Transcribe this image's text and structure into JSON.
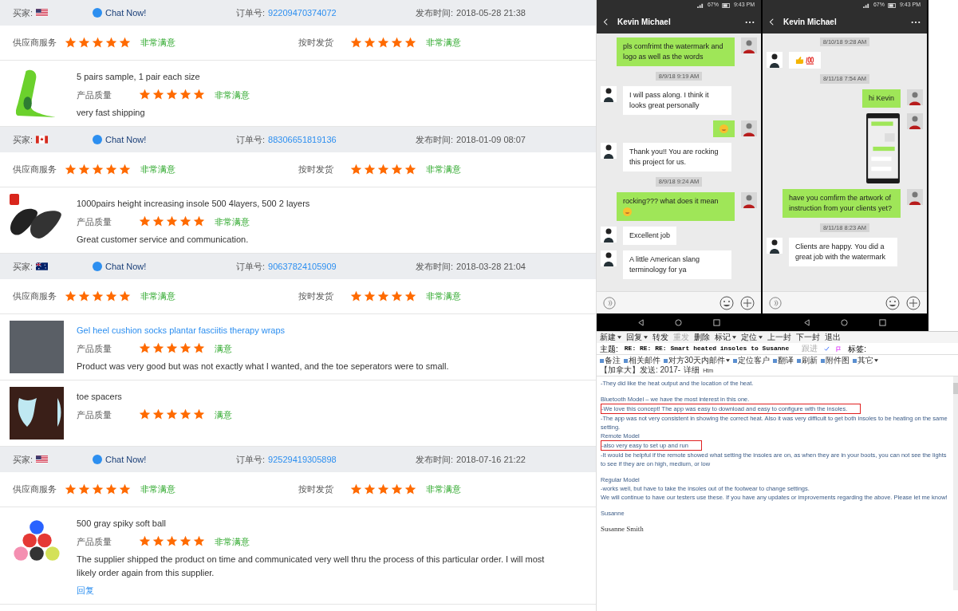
{
  "reviews": [
    {
      "buyer": {
        "label": "买家:",
        "kind": "us"
      },
      "chat": "Chat Now!",
      "order_label": "订单号:",
      "order_no": "92209470374072",
      "date_label": "发布时间:",
      "date": "2018-05-28 21:38",
      "ratings": [
        {
          "label": "供应商服务",
          "stars": 5,
          "verdict": "非常满意"
        },
        {
          "label": "按时发货",
          "stars": 5,
          "verdict": "非常满意"
        }
      ],
      "products": [
        {
          "kind": "green-insole",
          "hot": false,
          "title": "5 pairs sample, 1 pair each size",
          "link": false,
          "rating_label": "产品质量",
          "stars": 5,
          "verdict": "非常满意",
          "comment": "very fast shipping"
        }
      ]
    },
    {
      "buyer": {
        "label": "买家:",
        "kind": "ca"
      },
      "chat": "Chat Now!",
      "order_label": "订单号:",
      "order_no": "88306651819136",
      "date_label": "发布时间:",
      "date": "2018-01-09 08:07",
      "ratings": [
        {
          "label": "供应商服务",
          "stars": 5,
          "verdict": "非常满意"
        },
        {
          "label": "按时发货",
          "stars": 5,
          "verdict": "非常满意"
        }
      ],
      "products": [
        {
          "kind": "black-insole",
          "hot": true,
          "title": "1000pairs height increasing insole 500 4layers, 500 2 layers",
          "link": false,
          "rating_label": "产品质量",
          "stars": 5,
          "verdict": "非常满意",
          "comment": "Great customer service and communication."
        }
      ]
    },
    {
      "buyer": {
        "label": "买家:",
        "kind": "au"
      },
      "chat": "Chat Now!",
      "order_label": "订单号:",
      "order_no": "90637824105909",
      "date_label": "发布时间:",
      "date": "2018-03-28 21:04",
      "ratings": [
        {
          "label": "供应商服务",
          "stars": 5,
          "verdict": "非常满意"
        },
        {
          "label": "按时发货",
          "stars": 5,
          "verdict": "非常满意"
        }
      ],
      "products": [
        {
          "kind": "sock",
          "hot": false,
          "title": "Gel heel cushion socks plantar fasciitis therapy wraps",
          "link": true,
          "rating_label": "产品质量",
          "stars": 5,
          "verdict": "满意",
          "comment": "Product was very good but was not exactly what I wanted, and the toe seperators were to small."
        },
        {
          "kind": "toe-spacer",
          "hot": false,
          "title": "toe spacers",
          "link": false,
          "rating_label": "产品质量",
          "stars": 5,
          "verdict": "满意"
        }
      ]
    },
    {
      "buyer": {
        "label": "买家:",
        "kind": "us"
      },
      "chat": "Chat Now!",
      "order_label": "订单号:",
      "order_no": "92529419305898",
      "date_label": "发布时间:",
      "date": "2018-07-16 21:22",
      "ratings": [
        {
          "label": "供应商服务",
          "stars": 5,
          "verdict": "非常满意"
        },
        {
          "label": "按时发货",
          "stars": 5,
          "verdict": "非常满意"
        }
      ],
      "products": [
        {
          "kind": "balls",
          "hot": false,
          "title": "500 gray spiky soft ball",
          "link": false,
          "rating_label": "产品质量",
          "stars": 5,
          "verdict": "非常满意",
          "comment": "The supplier shipped the product on time and communicated very well thru the process of this particular order.  I will most likely order again from this supplier.",
          "reply": "回复"
        }
      ]
    }
  ],
  "phones": [
    {
      "battery": "67%",
      "time": "9:43 PM",
      "title": "Kevin Michael",
      "messages": [
        {
          "kind": "out",
          "text": "pls comfrimt the watermark and logo as well as the words",
          "emoji": false
        },
        {
          "kind": "time",
          "text": "8/9/18 9:19 AM"
        },
        {
          "kind": "in",
          "text": "I will pass along. I think it looks great personally",
          "emoji": false
        },
        {
          "kind": "out_emoji"
        },
        {
          "kind": "in",
          "text": "Thank you!!  You are rocking this project for us.",
          "emoji": false
        },
        {
          "kind": "time",
          "text": "8/9/18 9:24 AM"
        },
        {
          "kind": "out",
          "text": "rocking??? what does it mean",
          "emoji": true
        },
        {
          "kind": "in",
          "text": "Excellent job",
          "emoji": false
        },
        {
          "kind": "in",
          "text": "A little American slang terminology for ya",
          "emoji": false
        }
      ]
    },
    {
      "battery": "67%",
      "time": "9:43 PM",
      "title": "Kevin Michael",
      "messages": [
        {
          "kind": "time",
          "text": "8/10/18 9:28 AM"
        },
        {
          "kind": "in_emoji"
        },
        {
          "kind": "time",
          "text": "8/11/18 7:54 AM"
        },
        {
          "kind": "out",
          "text": "hi Kevin",
          "emoji": false
        },
        {
          "kind": "out_image"
        },
        {
          "kind": "out",
          "text": "have you comfirm the artwork of instruction from your clients yet?",
          "emoji": false
        },
        {
          "kind": "time",
          "text": "8/11/18 8:23 AM"
        },
        {
          "kind": "in",
          "text": "Clients are happy.  You did a great job with the watermark",
          "emoji": false
        }
      ]
    }
  ],
  "email": {
    "toolbar": [
      {
        "label": "新建",
        "menu": true,
        "disabled": false
      },
      {
        "label": "回复",
        "menu": true,
        "disabled": false
      },
      {
        "label": "转发",
        "menu": false,
        "disabled": false
      },
      {
        "label": "重发",
        "menu": false,
        "disabled": true
      },
      {
        "label": "删除",
        "menu": false,
        "disabled": false
      },
      {
        "label": "标记",
        "menu": true,
        "disabled": false
      },
      {
        "label": "定位",
        "menu": true,
        "disabled": false
      },
      {
        "label": "上一封",
        "menu": false,
        "disabled": false
      },
      {
        "label": "下一封",
        "menu": false,
        "disabled": false
      },
      {
        "label": "退出",
        "menu": false,
        "disabled": false
      }
    ],
    "subject_label": "主题:",
    "subject": "RE: RE: RE: Smart heated insoles to Susanne",
    "follow_up": "跟进",
    "tags_label": "标签:",
    "actions": [
      {
        "label": "备注",
        "menu": false
      },
      {
        "label": "相关邮件",
        "menu": false
      },
      {
        "label": "对方30天内邮件",
        "menu": true
      },
      {
        "label": "定位客户",
        "menu": false
      },
      {
        "label": "翻译",
        "menu": false
      },
      {
        "label": "刷新",
        "menu": false
      },
      {
        "label": "附件图",
        "menu": false
      },
      {
        "label": "其它",
        "menu": true
      }
    ],
    "sent": "【加拿大】发送: 2017-",
    "details": "详细",
    "html": "Htm",
    "paragraphs": [
      [
        {
          "text": "-They did like the heat output and the location of the heat.",
          "highlighted": false
        }
      ],
      [
        {
          "text": "Bluetooth Model – we have the most interest in this one.",
          "highlighted": false
        },
        {
          "text": "-We love this concept! The app was easy to download and easy to configure with the insoles.",
          "highlighted": true
        },
        {
          "text": "-The app was not very consistent in showing the correct heat. Also it was very difficult to get both insoles to be heating on the same setting.",
          "highlighted": false
        },
        {
          "text": "Remote Model",
          "highlighted": false
        },
        {
          "text": "-also very easy to set up and run",
          "highlighted": true
        },
        {
          "text": "-It would be helpful if the remote showed what setting the insoles are on, as when they are in your boots, you can not see the lights to see if they are on high, medium, or low",
          "highlighted": false
        }
      ],
      [
        {
          "text": "Regular Model",
          "highlighted": false
        },
        {
          "text": "-works well, but have to take the insoles out of the footwear to change settings.",
          "highlighted": false
        },
        {
          "text": "We will continue to have our testers use these. If you have any updates or improvements regarding the above. Please let me know!",
          "highlighted": false
        }
      ],
      [
        {
          "text": "Susanne",
          "highlighted": false
        }
      ]
    ],
    "signature": "Susanne Smith"
  }
}
